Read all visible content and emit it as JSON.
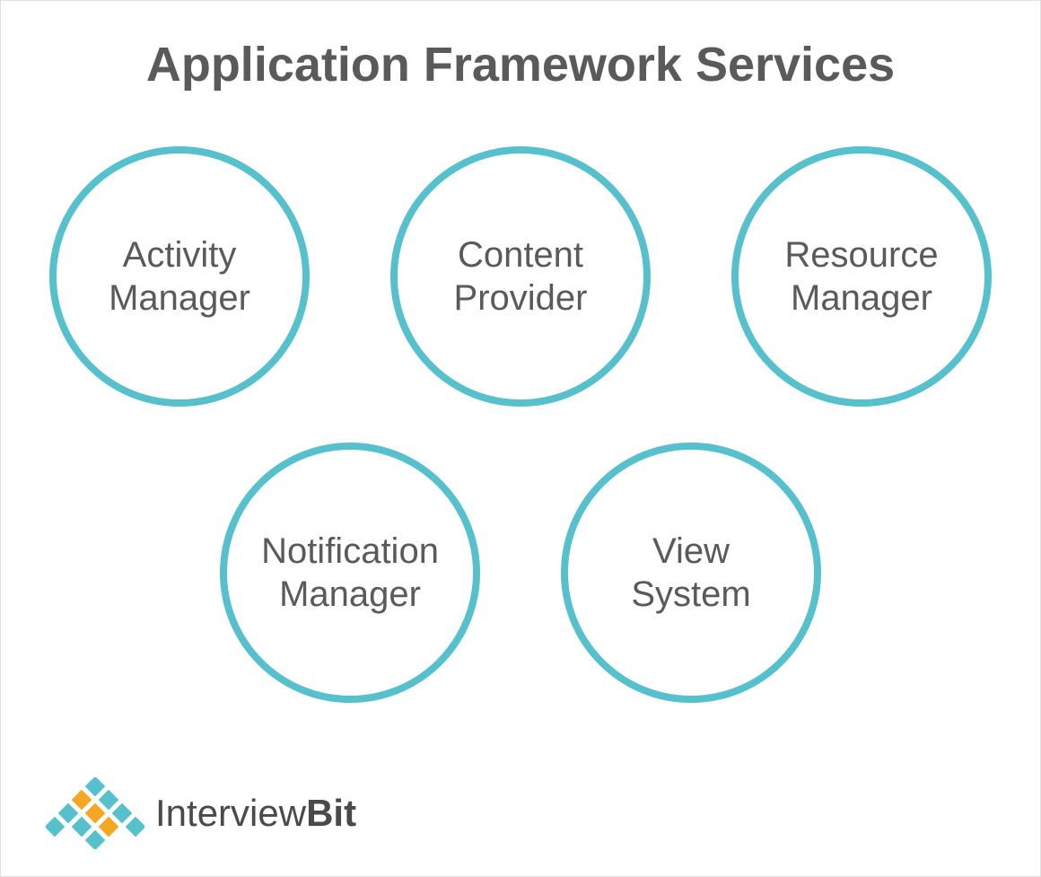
{
  "title": "Application Framework Services",
  "circles": {
    "row1": [
      {
        "line1": "Activity",
        "line2": "Manager"
      },
      {
        "line1": "Content",
        "line2": "Provider"
      },
      {
        "line1": "Resource",
        "line2": "Manager"
      }
    ],
    "row2": [
      {
        "line1": "Notification",
        "line2": "Manager"
      },
      {
        "line1": "View",
        "line2": "System"
      }
    ]
  },
  "logo": {
    "part1": "Interview",
    "part2": "Bit"
  },
  "colors": {
    "circleBorder": "#56c1cc",
    "text": "#5a5a5a",
    "logoTeal": "#56c1cc",
    "logoOrange": "#f5a623"
  }
}
